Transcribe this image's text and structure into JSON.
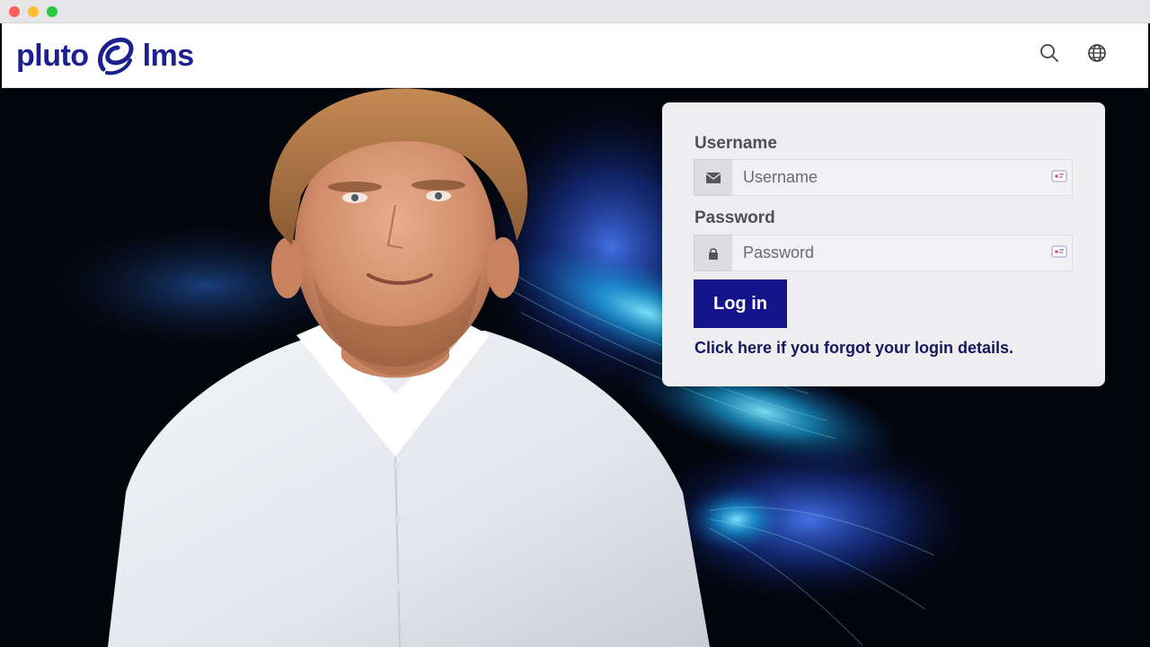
{
  "window": {
    "controls": [
      "close",
      "minimize",
      "maximize"
    ]
  },
  "header": {
    "brand_left": "pluto",
    "brand_right": "lms",
    "logo_icon": "pluto-swirl-logo",
    "search_icon": "search-icon",
    "language_icon": "globe-icon",
    "brand_color": "#1b1f8f"
  },
  "login": {
    "username_label": "Username",
    "username_placeholder": "Username",
    "username_icon": "envelope-icon",
    "password_label": "Password",
    "password_placeholder": "Password",
    "password_icon": "lock-icon",
    "login_button": "Log in",
    "forgot_link": "Click here if you forgot your login details.",
    "button_color": "#15158b"
  }
}
